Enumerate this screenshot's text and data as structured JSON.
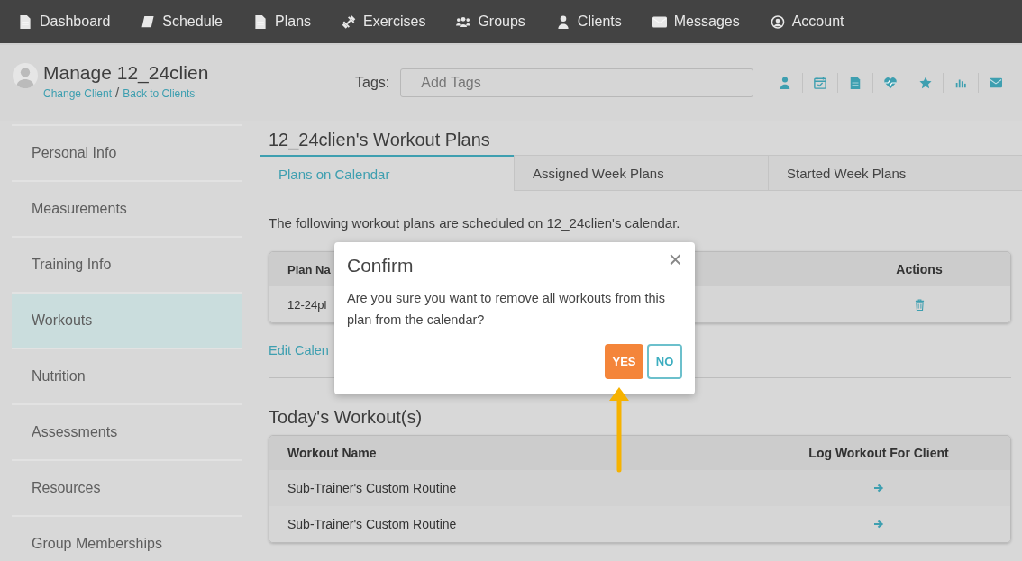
{
  "nav": [
    {
      "label": "Dashboard"
    },
    {
      "label": "Schedule"
    },
    {
      "label": "Plans"
    },
    {
      "label": "Exercises"
    },
    {
      "label": "Groups"
    },
    {
      "label": "Clients"
    },
    {
      "label": "Messages"
    },
    {
      "label": "Account"
    }
  ],
  "client": {
    "title": "Manage 12_24clien",
    "change_link": "Change Client",
    "separator": "/",
    "back_link": "Back to Clients"
  },
  "tags": {
    "label": "Tags:",
    "placeholder": "Add Tags"
  },
  "sidebar": {
    "items": [
      {
        "label": "Personal Info",
        "selected": false
      },
      {
        "label": "Measurements",
        "selected": false
      },
      {
        "label": "Training Info",
        "selected": false
      },
      {
        "label": "Workouts",
        "selected": true
      },
      {
        "label": "Nutrition",
        "selected": false
      },
      {
        "label": "Assessments",
        "selected": false
      },
      {
        "label": "Resources",
        "selected": false
      },
      {
        "label": "Group Memberships",
        "selected": false
      }
    ]
  },
  "section_title": "12_24clien's Workout Plans",
  "tabs": [
    {
      "label": "Plans on Calendar",
      "selected": true
    },
    {
      "label": "Assigned Week Plans",
      "selected": false
    },
    {
      "label": "Started Week Plans",
      "selected": false
    }
  ],
  "intro": "The following workout plans are scheduled on 12_24clien's calendar.",
  "plans_table": {
    "columns": [
      "Plan Na",
      "Actions"
    ],
    "rows": [
      {
        "name": "12-24pl"
      }
    ]
  },
  "edit_link": "Edit Calen",
  "today_title": "Today's Workout(s)",
  "today_table": {
    "columns": [
      "Workout Name",
      "Log Workout For Client"
    ],
    "rows": [
      {
        "name": "Sub-Trainer's Custom Routine"
      },
      {
        "name": "Sub-Trainer's Custom Routine"
      }
    ]
  },
  "modal": {
    "title": "Confirm",
    "close": "×",
    "message": "Are you sure you want to remove all workouts from this plan from the calendar?",
    "yes": "YES",
    "no": "NO"
  }
}
